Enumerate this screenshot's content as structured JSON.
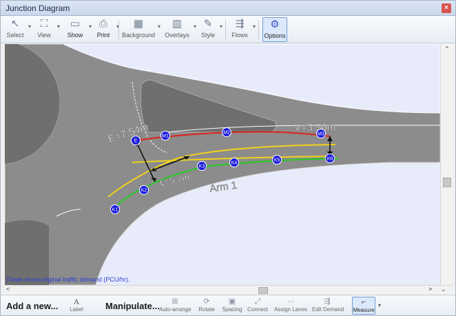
{
  "window": {
    "title": "Junction Diagram",
    "close_glyph": "×"
  },
  "toolbar": {
    "items": [
      {
        "label": "Select",
        "icon": "cursor-icon",
        "glyph": "↖"
      },
      {
        "label": "View",
        "icon": "binoculars-icon",
        "glyph": "⛶"
      },
      {
        "label": "Show",
        "icon": "window-icon",
        "glyph": "▭"
      },
      {
        "label": "Print",
        "icon": "printer-icon",
        "glyph": "⎙"
      },
      {
        "label": "Background",
        "icon": "background-icon",
        "glyph": "▦"
      },
      {
        "label": "Overlays",
        "icon": "overlays-icon",
        "glyph": "▥"
      },
      {
        "label": "Style",
        "icon": "pen-icon",
        "glyph": "✎"
      },
      {
        "label": "Flows",
        "icon": "flows-icon",
        "glyph": "⇶"
      },
      {
        "label": "Options",
        "icon": "gear-icon",
        "glyph": "⚙"
      }
    ]
  },
  "diagram": {
    "measurements": {
      "e": "E=7.54m",
      "v": "V=3.56m",
      "l": "L=5.7m"
    },
    "arm_label": "Arm 1",
    "points": {
      "e": "E",
      "m1": "M1",
      "m2": "M2",
      "m3": "M3",
      "k1": "K1",
      "k2": "K2",
      "k3": "K3",
      "k4": "K4",
      "k5": "K5",
      "k6": "K6"
    },
    "footnote": "Flows show original traffic demand (PCU/hr).",
    "colors": {
      "road": "#8c8c8c",
      "canvas": "#e8ecfa",
      "red_line": "#e0201c",
      "green_line": "#22cc22",
      "yellow_line": "#f2d21b",
      "point": "#1a1adc"
    }
  },
  "scrollbars": {
    "up": "⌃",
    "left": "<",
    "right": ">",
    "down": "⌄"
  },
  "bottombar": {
    "add_label": "Add a new...",
    "manipulate_label": "Manipulate...",
    "items": [
      {
        "label": "Label",
        "icon": "label-icon",
        "glyph": "A"
      },
      {
        "label": "Auto-arrange",
        "icon": "auto-arrange-icon",
        "glyph": "⊞"
      },
      {
        "label": "Rotate",
        "icon": "rotate-icon",
        "glyph": "⟳"
      },
      {
        "label": "Spacing",
        "icon": "spacing-icon",
        "glyph": "▣"
      },
      {
        "label": "Connect",
        "icon": "connect-icon",
        "glyph": "⤢"
      },
      {
        "label": "Assign Lanes",
        "icon": "assign-lanes-icon",
        "glyph": "⋯"
      },
      {
        "label": "Edit Demand",
        "icon": "edit-demand-icon",
        "glyph": "⇶"
      },
      {
        "label": "Measure",
        "icon": "ruler-icon",
        "glyph": "⌐"
      }
    ]
  }
}
